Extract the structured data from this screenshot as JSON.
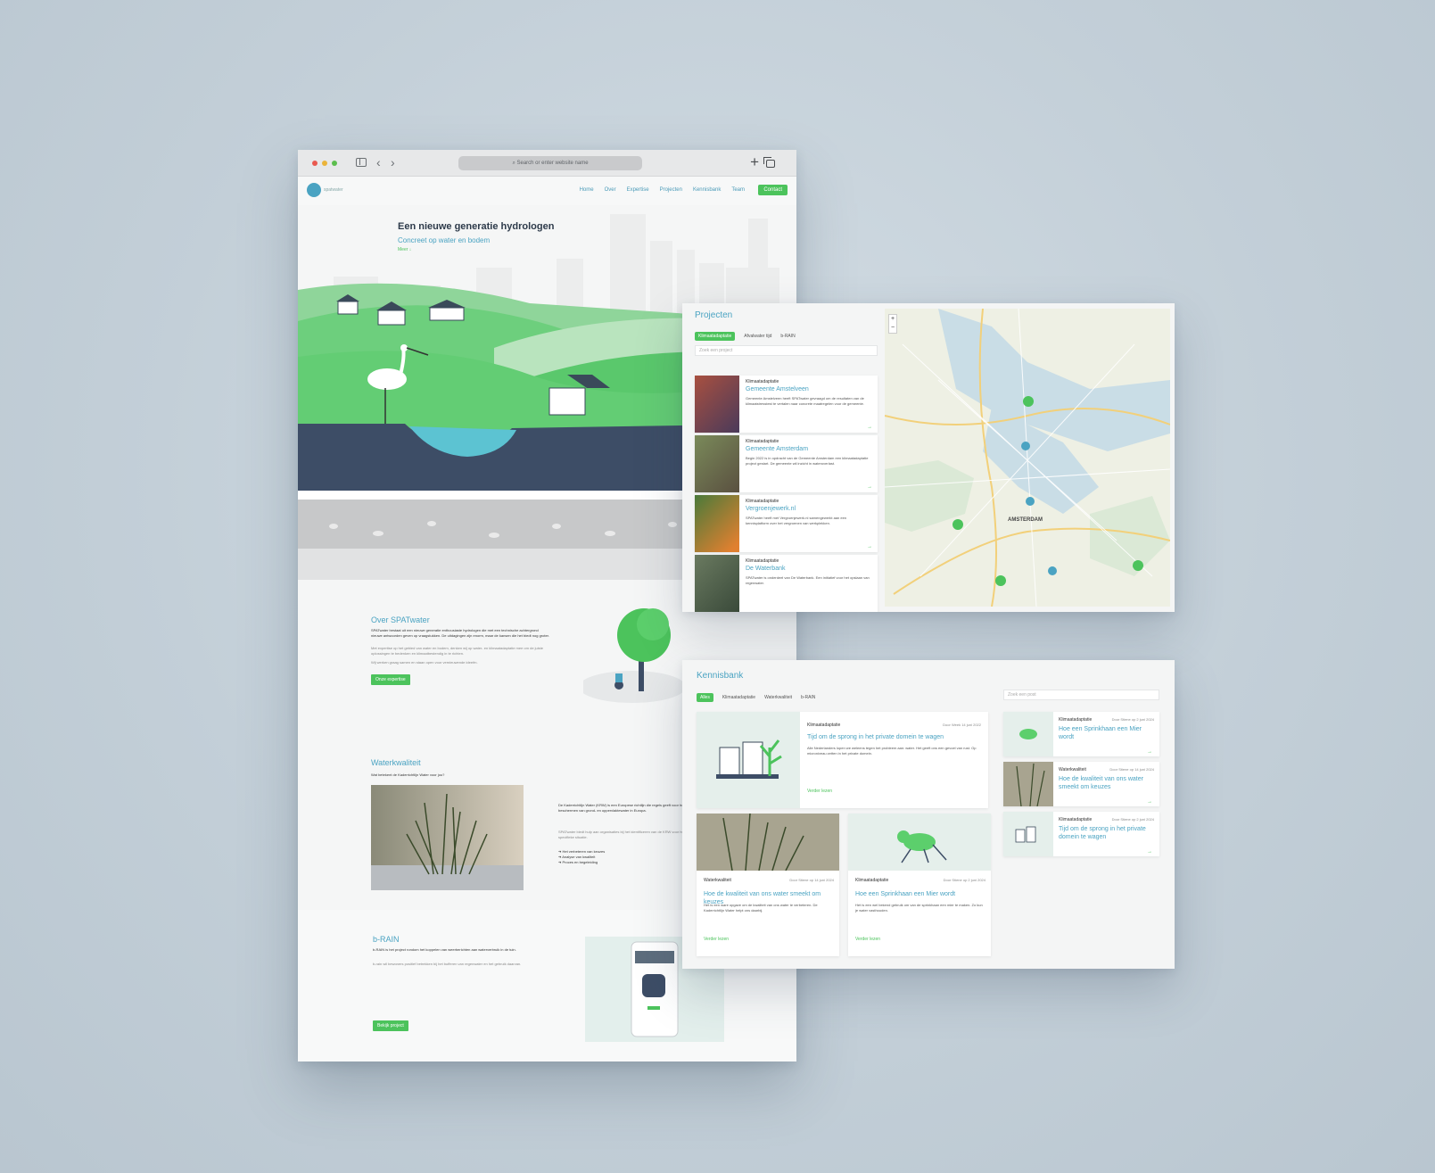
{
  "browser": {
    "address_placeholder": "Search or enter website name",
    "nav": {
      "logo": "spatwater",
      "links": [
        "Home",
        "Over",
        "Expertise",
        "Projecten",
        "Kennisbank",
        "Team"
      ],
      "contact": "Contact"
    },
    "hero": {
      "title": "Een nieuwe generatie hydrologen",
      "subtitle": "Concreet op water en bodem",
      "more": "Meer ↓"
    },
    "over": {
      "title": "Over SPATwater",
      "p1": "SPATwater bestaat uit een nieuwe generatie enthousiaste hydrologen die met een technische achtergrond nieuwe antwoorden geven op vraagstukken. De uitdagingen zijn enorm, maar de kansen die het biedt nog groter.",
      "p2": "Met expertise op het gebied van water en bodem, denken wij op water- en klimaatadaptatie mee om de juiste oplossingen te bedenken en klimaatbestendig in te richten.",
      "p3": "Wij werken graag samen en staan open voor vernieuwende ideeën.",
      "button": "Onze expertise"
    },
    "waterkwaliteit": {
      "title": "Waterkwaliteit",
      "question": "Wat betekent de Kaderrichtlijn Water voor jou?",
      "p1": "De Kaderrichtlijn Water (KRW) is een Europese richtlijn die regels geeft voor het beschermen van grond- en oppervlaktewater in Europa.",
      "p2": "SPATwater biedt hulp aan organisaties bij het identificeren van de KRW voor hun specifieke situatie.",
      "bullets": [
        "Het verbeteren van keuzes",
        "Analyse van kwaliteit",
        "Proces en begeleiding"
      ]
    },
    "brain": {
      "title": "b-RAIN",
      "p1": "b-RAIN is het project rondom het koppelen van weerberichten aan waterverbruik in de tuin.",
      "p2": "b-rain wil bewoners positief betrekken bij het bufferen van regenwater en het gebruik daarvan.",
      "button": "Bekijk project"
    }
  },
  "projecten": {
    "title": "Projecten",
    "filters": [
      "Klimaatadaptatie",
      "Afvalwater tijd",
      "b-RAIN"
    ],
    "search_placeholder": "Zoek een project",
    "items": [
      {
        "category": "Klimaatadaptatie",
        "name": "Gemeente Amstelveen",
        "desc": "Gemeente Amstelveen heeft SPATwater gevraagd om de resultaten van de klimaatstresstest te vertalen naar concrete maatregelen voor de gemeente.",
        "thumb": "#8a4a3a"
      },
      {
        "category": "Klimaatadaptatie",
        "name": "Gemeente Amsterdam",
        "desc": "Begin 2022 is in opdracht van de Gemeente Amsterdam een klimaatadaptatie project gestart. De gemeente wil inzicht in wateroverlast.",
        "thumb": "#6a7a4a"
      },
      {
        "category": "Klimaatadaptatie",
        "name": "Vergroenjewerk.nl",
        "desc": "SPATwater heeft met Vergroenjewerk.nl samengewerkt aan een kennisplatform over het vergroenen van werkplekken.",
        "thumb": "#4a6a3a"
      },
      {
        "category": "Klimaatadaptatie",
        "name": "De Waterbank",
        "desc": "SPATwater is onderdeel van De Waterbank. Een initiatief voor het opslaan van regenwater.",
        "thumb": "#5a6a50"
      }
    ],
    "map_label": "AMSTERDAM"
  },
  "kennisbank": {
    "title": "Kennisbank",
    "filters": [
      "Alles",
      "Klimaatadaptatie",
      "Waterkwaliteit",
      "b-RAIN"
    ],
    "search_placeholder": "Zoek een post",
    "featured": {
      "category": "Klimaatadaptatie",
      "date": "Door Week 14 juni 2022",
      "title": "Tijd om de sprong in het private domein te wagen",
      "desc": "Alle Nederlanders lopen we weleens tegen het probleem aan: water. Het geeft ons een gevoel van rust. Op microniveau zetten in het private domein.",
      "link": "Verder lezen"
    },
    "cards": [
      {
        "category": "Waterkwaliteit",
        "date": "Door Stiene op 14 juni 2024",
        "title": "Hoe de kwaliteit van ons water smeekt om keuzes",
        "desc": "Het is een ware opgave om de kwaliteit van ons water te verbeteren. De Kaderrichtlijn Water helpt ons daarbij.",
        "link": "Verder lezen"
      },
      {
        "category": "Klimaatadaptatie",
        "date": "Door Stiene op 2 juni 2024",
        "title": "Hoe een Sprinkhaan een Mier wordt",
        "desc": "Het is een wel bekend gebruik om van de sprinkhaan een mier te maken. Zo kun je water vasthouden.",
        "link": "Verder lezen"
      }
    ],
    "side": [
      {
        "category": "Klimaatadaptatie",
        "date": "Door Stiene op 2 juni 2024",
        "title": "Hoe een Sprinkhaan een Mier wordt"
      },
      {
        "category": "Waterkwaliteit",
        "date": "Door Stiene op 14 juni 2024",
        "title": "Hoe de kwaliteit van ons water smeekt om keuzes"
      },
      {
        "category": "Klimaatadaptatie",
        "date": "Door Stiene op 2 juni 2024",
        "title": "Tijd om de sprong in het private domein te wagen"
      }
    ]
  },
  "colors": {
    "accent": "#4aa3c2",
    "green": "#4cc35c",
    "background": "#c4d0d9"
  }
}
